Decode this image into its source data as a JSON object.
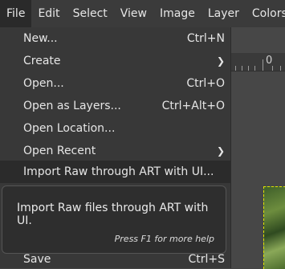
{
  "menubar": {
    "items": [
      "File",
      "Edit",
      "Select",
      "View",
      "Image",
      "Layer",
      "Colors"
    ]
  },
  "ruler": {
    "label": "0"
  },
  "file_menu": {
    "items": [
      {
        "label": "New...",
        "accel": "Ctrl+N"
      },
      {
        "label": "Create",
        "submenu": true
      },
      {
        "label": "Open...",
        "accel": "Ctrl+O"
      },
      {
        "label": "Open as Layers...",
        "accel": "Ctrl+Alt+O"
      },
      {
        "label": "Open Location...",
        "accel": ""
      },
      {
        "label": "Open Recent",
        "submenu": true
      },
      {
        "label": "Import Raw through ART with UI...",
        "accel": "",
        "highlighted": true
      },
      {
        "label": "Save",
        "accel": "Ctrl+S"
      }
    ]
  },
  "tooltip": {
    "text": "Import Raw files through ART with UI.",
    "help": "Press F1 for more help"
  },
  "colors": {
    "menubar_bg": "#3b3b3b",
    "menu_bg": "#383838",
    "highlight": "#2b2b2b"
  },
  "icons": {
    "submenu": "chevron-right-icon"
  }
}
